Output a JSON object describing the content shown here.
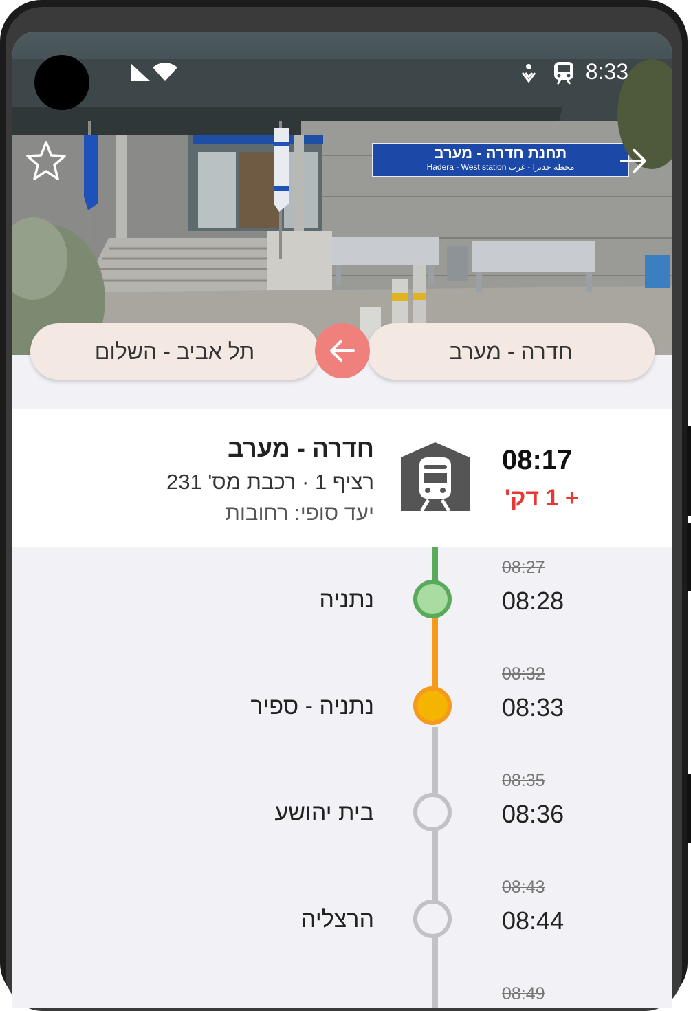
{
  "status_bar": {
    "time": "8:33",
    "icons": [
      "signal-icon",
      "wifi-icon",
      "accessibility-icon",
      "train-icon"
    ]
  },
  "hero": {
    "sign_main": "תחנת חדרה - מערב",
    "sign_sub": "Hadera - West station محطة حديرا - غرب"
  },
  "route": {
    "origin": "חדרה - מערב",
    "destination": "תל אביב - השלום"
  },
  "departure": {
    "station": "חדרה - מערב",
    "details": "רציף 1 · רכבת מס' 231",
    "final_destination": "יעד סופי: רחובות",
    "time": "08:17",
    "delay": "+ 1 דק'"
  },
  "stops": [
    {
      "name": "נתניה",
      "scheduled": "08:27",
      "actual": "08:28",
      "state": "passed"
    },
    {
      "name": "נתניה - ספיר",
      "scheduled": "08:32",
      "actual": "08:33",
      "state": "current"
    },
    {
      "name": "בית יהושע",
      "scheduled": "08:35",
      "actual": "08:36",
      "state": "upcoming"
    },
    {
      "name": "הרצליה",
      "scheduled": "08:43",
      "actual": "08:44",
      "state": "upcoming"
    },
    {
      "name": "",
      "scheduled": "08:49",
      "actual": "",
      "state": "upcoming"
    }
  ],
  "colors": {
    "passed_line": "#5aaa5c",
    "passed_fill": "#a8dca0",
    "current_line": "#f59a1a",
    "current_fill": "#f5b400",
    "upcoming_line": "#c2c2c6",
    "swap_button": "#f0807c",
    "delay": "#e53935",
    "pill": "#f4e9e2"
  }
}
